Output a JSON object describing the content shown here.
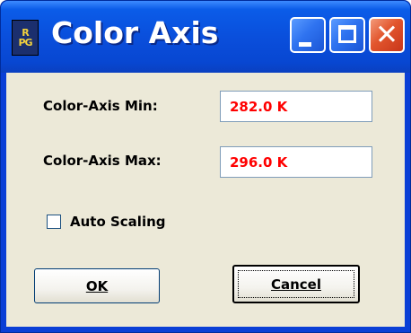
{
  "window": {
    "title": "Color Axis",
    "icon_text": [
      "R",
      "PG"
    ]
  },
  "fields": {
    "min_label": "Color-Axis Min:",
    "min_value": "282.0 K",
    "max_label": "Color-Axis Max:",
    "max_value": "296.0 K"
  },
  "auto_scaling": {
    "label": "Auto Scaling",
    "checked": false
  },
  "buttons": {
    "ok_label": "OK",
    "cancel_label": "Cancel"
  },
  "colors": {
    "value_text": "#ff0000",
    "titlebar": "#0a4fdc",
    "client_bg": "#ece9d8"
  }
}
